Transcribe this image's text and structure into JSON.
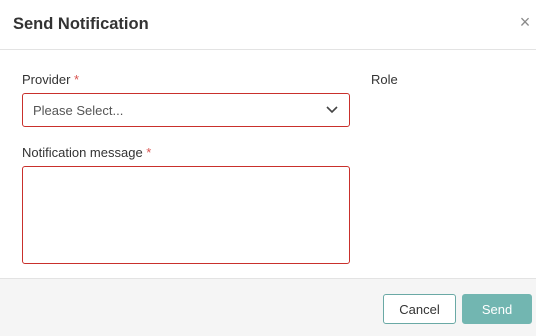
{
  "dialog": {
    "title": "Send Notification",
    "close_symbol": "×"
  },
  "form": {
    "provider": {
      "label": "Provider",
      "required_mark": "*",
      "placeholder": "Please Select..."
    },
    "role": {
      "label": "Role"
    },
    "message": {
      "label": "Notification message",
      "required_mark": "*",
      "value": ""
    }
  },
  "footer": {
    "cancel_label": "Cancel",
    "send_label": "Send"
  },
  "colors": {
    "error_border": "#c9302c",
    "required_asterisk": "#d9534f",
    "primary_button": "#72b6b1",
    "secondary_button_border": "#6aa9a5"
  },
  "icons": {
    "close": "close-icon",
    "dropdown": "chevron-down-icon"
  }
}
